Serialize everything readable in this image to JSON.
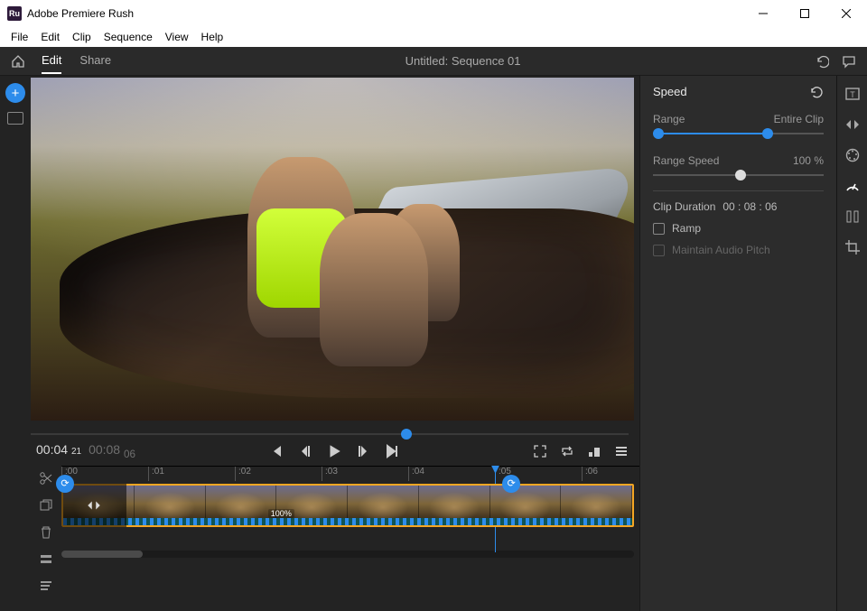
{
  "window": {
    "title": "Adobe Premiere Rush"
  },
  "menubar": {
    "items": [
      "File",
      "Edit",
      "Clip",
      "Sequence",
      "View",
      "Help"
    ]
  },
  "topbar": {
    "tabs": {
      "edit": "Edit",
      "share": "Share"
    },
    "doc_title": "Untitled: Sequence 01"
  },
  "playback": {
    "current_tc": "00:04",
    "current_frames": "21",
    "total_tc": "00:08",
    "total_frames": "06"
  },
  "timeline": {
    "marks": [
      ":00",
      ":01",
      ":02",
      ":03",
      ":04",
      ":05",
      ":06"
    ],
    "playhead_pct": 68,
    "clip_label": "100%"
  },
  "speed_panel": {
    "title": "Speed",
    "range_label": "Range",
    "entire_clip_label": "Entire Clip",
    "range_speed_label": "Range Speed",
    "range_speed_value": "100",
    "pct": "%",
    "duration_label": "Clip Duration",
    "duration_value": "00 : 08 : 06",
    "ramp_label": "Ramp",
    "maintain_label": "Maintain Audio Pitch",
    "range_start_pct": 2,
    "range_end_pct": 66,
    "speed_pos_pct": 50
  },
  "icons": {
    "home": "home",
    "undo": "undo",
    "comment": "comment",
    "titles": "titles",
    "transitions": "transitions",
    "color": "color",
    "speed": "speed",
    "audio": "audio",
    "crop": "crop",
    "scissors": "scissors",
    "add_track": "add_track",
    "trash": "trash",
    "expand": "expand",
    "list": "list"
  }
}
